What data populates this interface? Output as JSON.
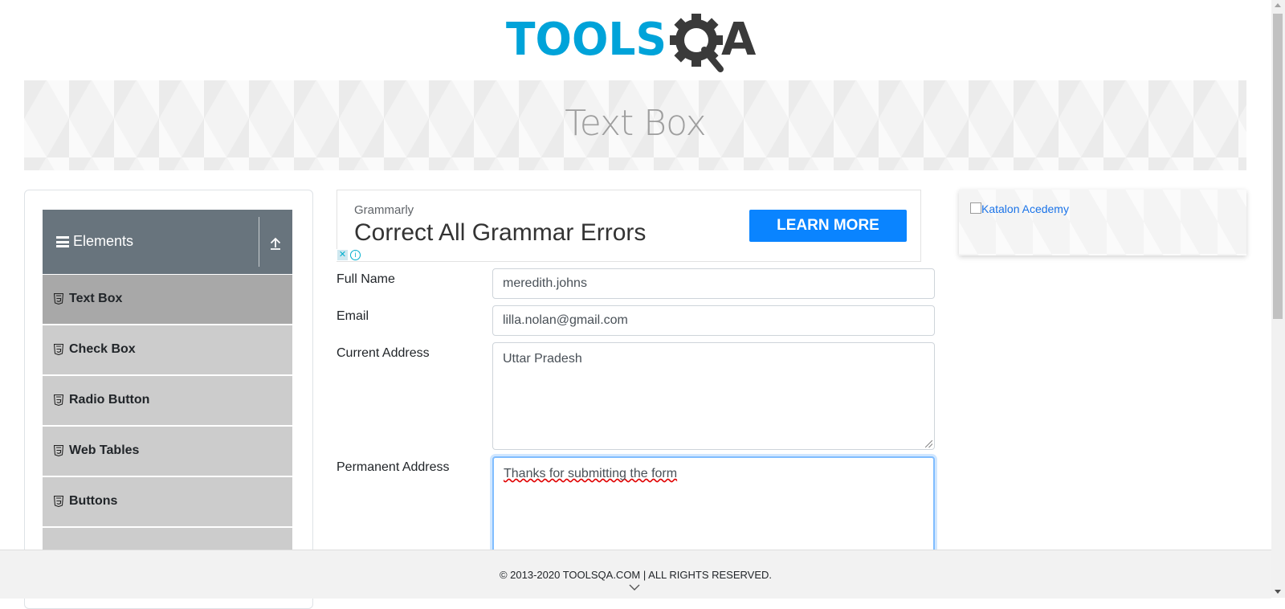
{
  "header": {
    "logo_text_left": "TOOLS",
    "logo_text_right": "A",
    "logo_colors": {
      "blue": "#00a3d9",
      "dark": "#3a3a3a"
    }
  },
  "banner": {
    "title": "Text Box"
  },
  "sidebar": {
    "group": {
      "label": "Elements",
      "icon": "hamburger-icon",
      "collapse_icon": "arrow-up-icon"
    },
    "items": [
      {
        "label": "Text Box",
        "icon": "html5-icon",
        "active": true
      },
      {
        "label": "Check Box",
        "icon": "html5-icon"
      },
      {
        "label": "Radio Button",
        "icon": "html5-icon"
      },
      {
        "label": "Web Tables",
        "icon": "html5-icon"
      },
      {
        "label": "Buttons",
        "icon": "html5-icon"
      }
    ]
  },
  "ad": {
    "brand": "Grammarly",
    "headline": "Correct All Grammar Errors",
    "cta": "LEARN MORE",
    "cta_color": "#0a84ff"
  },
  "form": {
    "full_name": {
      "label": "Full Name",
      "value": "meredith.johns"
    },
    "email": {
      "label": "Email",
      "value": "lilla.nolan@gmail.com"
    },
    "current_address": {
      "label": "Current Address",
      "value": "Uttar Pradesh"
    },
    "permanent_address": {
      "label": "Permanent Address",
      "value": "Thanks for submitting the form"
    }
  },
  "right_ad": {
    "alt_text": "Katalon Acedemy"
  },
  "footer": {
    "copyright": "© 2013-2020 TOOLSQA.COM | ALL RIGHTS RESERVED."
  }
}
